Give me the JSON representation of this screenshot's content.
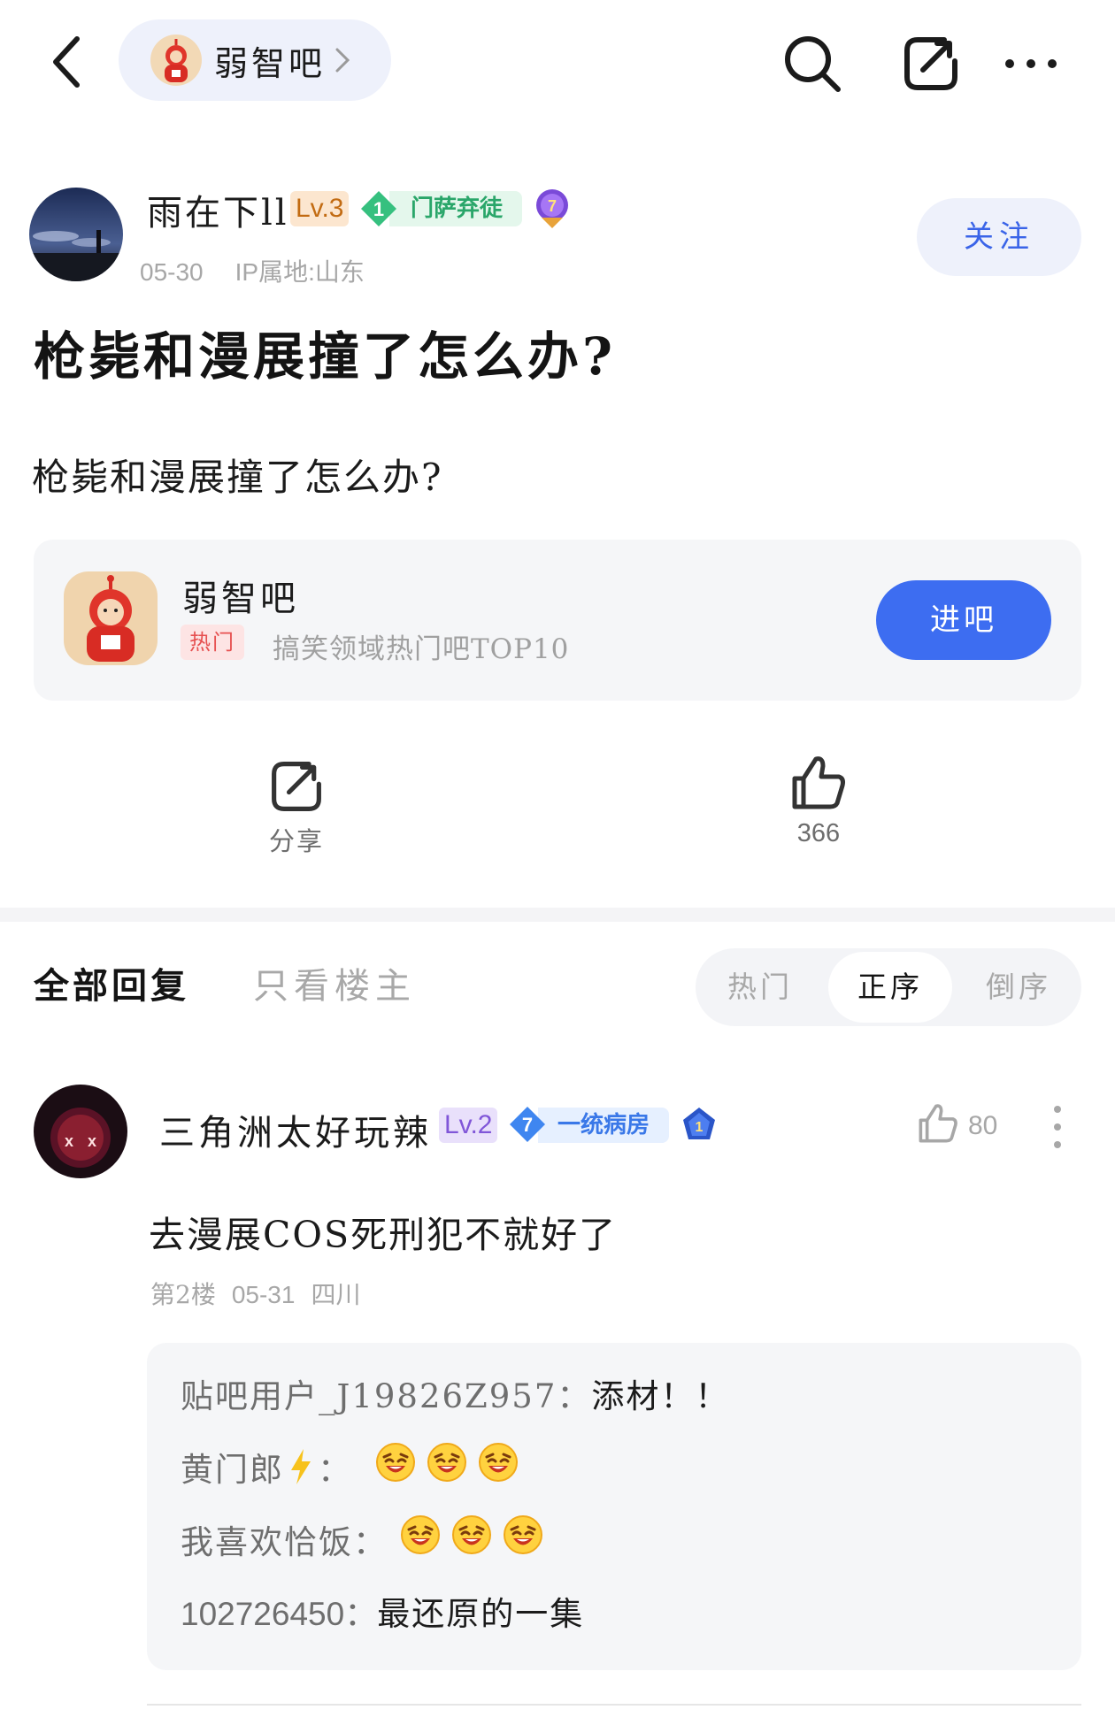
{
  "header": {
    "forum_name": "弱智吧"
  },
  "post": {
    "author": {
      "name": "雨在下ll",
      "level": "Lv.3",
      "fan_level": "1",
      "fan_title": "门萨弃徒",
      "medal_number": "7"
    },
    "date": "05-30",
    "ip_location": "IP属地:山东",
    "follow_label": "关注",
    "title": "枪毙和漫展撞了怎么办?",
    "content": "枪毙和漫展撞了怎么办?"
  },
  "forum_card": {
    "name": "弱智吧",
    "tag": "热门",
    "description": "搞笑领域热门吧TOP10",
    "enter_label": "进吧"
  },
  "actions": {
    "share_label": "分享",
    "like_count": "366"
  },
  "replies_header": {
    "tab_all": "全部回复",
    "tab_op_only": "只看楼主",
    "sort_options": [
      "热门",
      "正序",
      "倒序"
    ],
    "selected_sort": "正序"
  },
  "reply": {
    "author": {
      "name": "三角洲太好玩辣",
      "level": "Lv.2",
      "fan_level": "7",
      "fan_title": "一统病房",
      "medal_number": "1"
    },
    "like_count": "80",
    "content": "去漫展COS死刑犯不就好了",
    "floor": "第2楼",
    "date": "05-31",
    "location": "四川",
    "sub_replies": [
      {
        "user": "贴吧用户_J19826Z957：",
        "text": "添材！！",
        "emoji_count": 0
      },
      {
        "user": "黄门郎",
        "user_suffix": "：",
        "text": "",
        "emoji_count": 3,
        "emoji": "laughing-emoji",
        "user_icon": "lightning-icon"
      },
      {
        "user": "我喜欢恰饭：",
        "text": "",
        "emoji_count": 3,
        "emoji": "laughing-emoji"
      },
      {
        "user": "102726450：",
        "text": "最还原的一集",
        "emoji_count": 0
      }
    ]
  },
  "colors": {
    "accent_blue": "#3d6df1",
    "follow_text": "#3a64e8",
    "hot_tag": "#e65050",
    "lv3_badge": "#c26b12",
    "lv2_badge": "#8056d8",
    "fan_green": "#2aa66a",
    "fan_blue": "#3a78e8"
  }
}
